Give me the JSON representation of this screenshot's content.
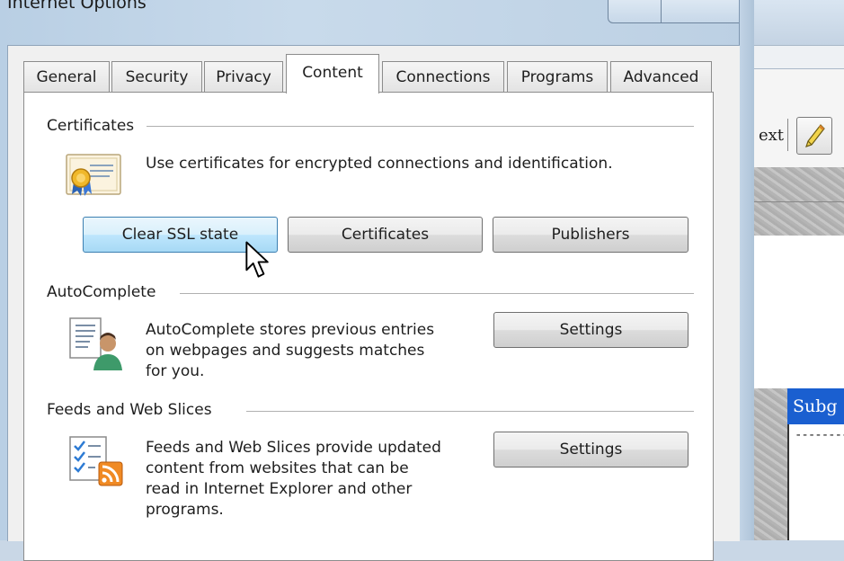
{
  "window": {
    "title": "Internet Options"
  },
  "tabs": [
    {
      "label": "General",
      "active": false
    },
    {
      "label": "Security",
      "active": false
    },
    {
      "label": "Privacy",
      "active": false
    },
    {
      "label": "Content",
      "active": true
    },
    {
      "label": "Connections",
      "active": false
    },
    {
      "label": "Programs",
      "active": false
    },
    {
      "label": "Advanced",
      "active": false
    }
  ],
  "certificates": {
    "group_label": "Certificates",
    "description": "Use certificates for encrypted connections and identification.",
    "icon": "certificate-icon",
    "buttons": {
      "clear_ssl": "Clear SSL state",
      "certificates": "Certificates",
      "publishers": "Publishers"
    }
  },
  "autocomplete": {
    "group_label": "AutoComplete",
    "description_lines": [
      "AutoComplete stores previous entries",
      "on webpages and suggests matches",
      "for you."
    ],
    "icon": "autocomplete-user-icon",
    "settings_label": "Settings"
  },
  "feeds": {
    "group_label": "Feeds and Web Slices",
    "description_lines": [
      "Feeds and Web Slices provide updated",
      "content from websites that can be",
      "read in Internet Explorer and other",
      "programs."
    ],
    "icon": "feed-checklist-icon",
    "settings_label": "Settings"
  },
  "background_window": {
    "toolbar_text": "ext",
    "header_cell_text": "Subg",
    "cell_text": "--------"
  },
  "colors": {
    "hover_button": "#bee6fd",
    "frame": "#c8daeb",
    "background_header": "#1a5fd0"
  }
}
